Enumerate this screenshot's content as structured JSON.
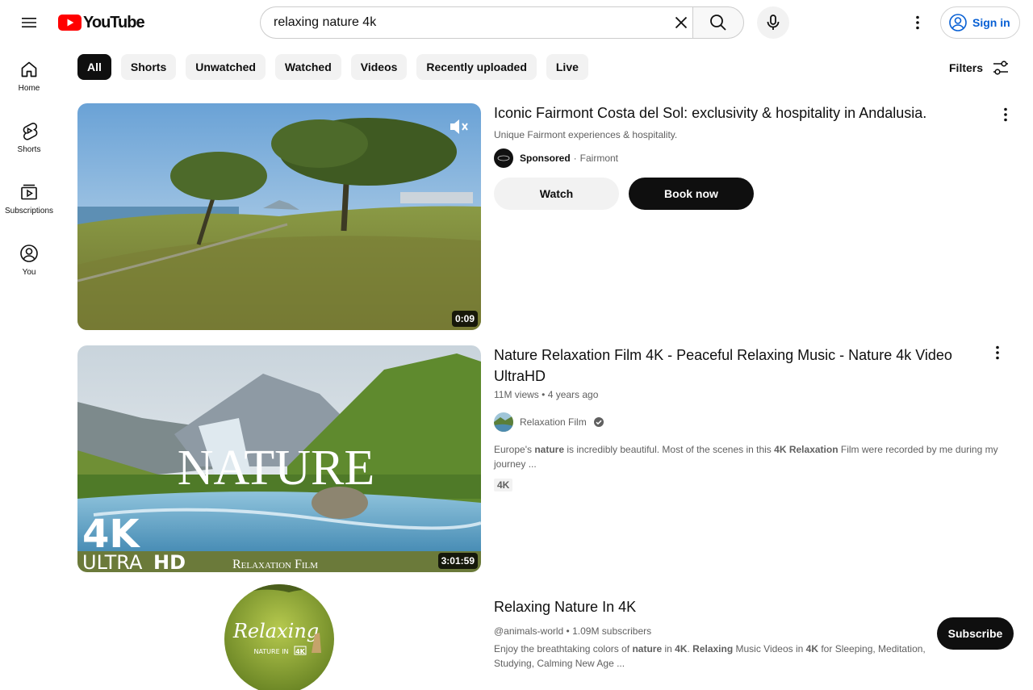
{
  "header": {
    "logo_text": "YouTube",
    "search_value": "relaxing nature 4k",
    "signin_label": "Sign in",
    "brand_color": "#ff0000",
    "link_color": "#065fd4"
  },
  "guide": {
    "items": [
      {
        "label": "Home",
        "icon": "home-icon"
      },
      {
        "label": "Shorts",
        "icon": "shorts-icon"
      },
      {
        "label": "Subscriptions",
        "icon": "subscriptions-icon"
      },
      {
        "label": "You",
        "icon": "account-icon"
      }
    ]
  },
  "chips": [
    "All",
    "Shorts",
    "Unwatched",
    "Watched",
    "Videos",
    "Recently uploaded",
    "Live"
  ],
  "filters_label": "Filters",
  "ad": {
    "title": "Iconic Fairmont Costa del Sol: exclusivity & hospitality in Andalusia.",
    "subtitle": "Unique Fairmont experiences & hospitality.",
    "sponsored": "Sponsored",
    "separator": "·",
    "advertiser": "Fairmont",
    "duration": "0:09",
    "watch_label": "Watch",
    "book_label": "Book now"
  },
  "video": {
    "title": "Nature Relaxation Film 4K - Peaceful Relaxing Music - Nature 4k Video UltraHD",
    "views": "11M views",
    "age": "4 years ago",
    "dot": "•",
    "channel": "Relaxation Film",
    "desc_parts": [
      "Europe's ",
      "nature",
      " is incredibly beautiful. Most of the scenes in this ",
      "4K",
      " ",
      "Relaxation",
      " Film were recorded by me during my journey ..."
    ],
    "badge": "4K",
    "duration": "3:01:59",
    "overlay_word": "NATURE",
    "overlay_4k": "4K",
    "overlay_ultra": "ULTRA",
    "overlay_hd": "HD",
    "overlay_brand": "Relaxation Film"
  },
  "channel": {
    "name": "Relaxing Nature In 4K",
    "handle": "@animals-world",
    "dot": "•",
    "subs": "1.09M subscribers",
    "desc_parts": [
      "Enjoy the breathtaking colors of ",
      "nature",
      " in ",
      "4K",
      ". ",
      "Relaxing",
      " Music Videos in ",
      "4K",
      " for Sleeping, Meditation, Studying, Calming New Age ..."
    ],
    "subscribe_label": "Subscribe",
    "avatar_script": "Relaxing",
    "avatar_sub": "NATURE IN",
    "avatar_4k": "4K"
  }
}
